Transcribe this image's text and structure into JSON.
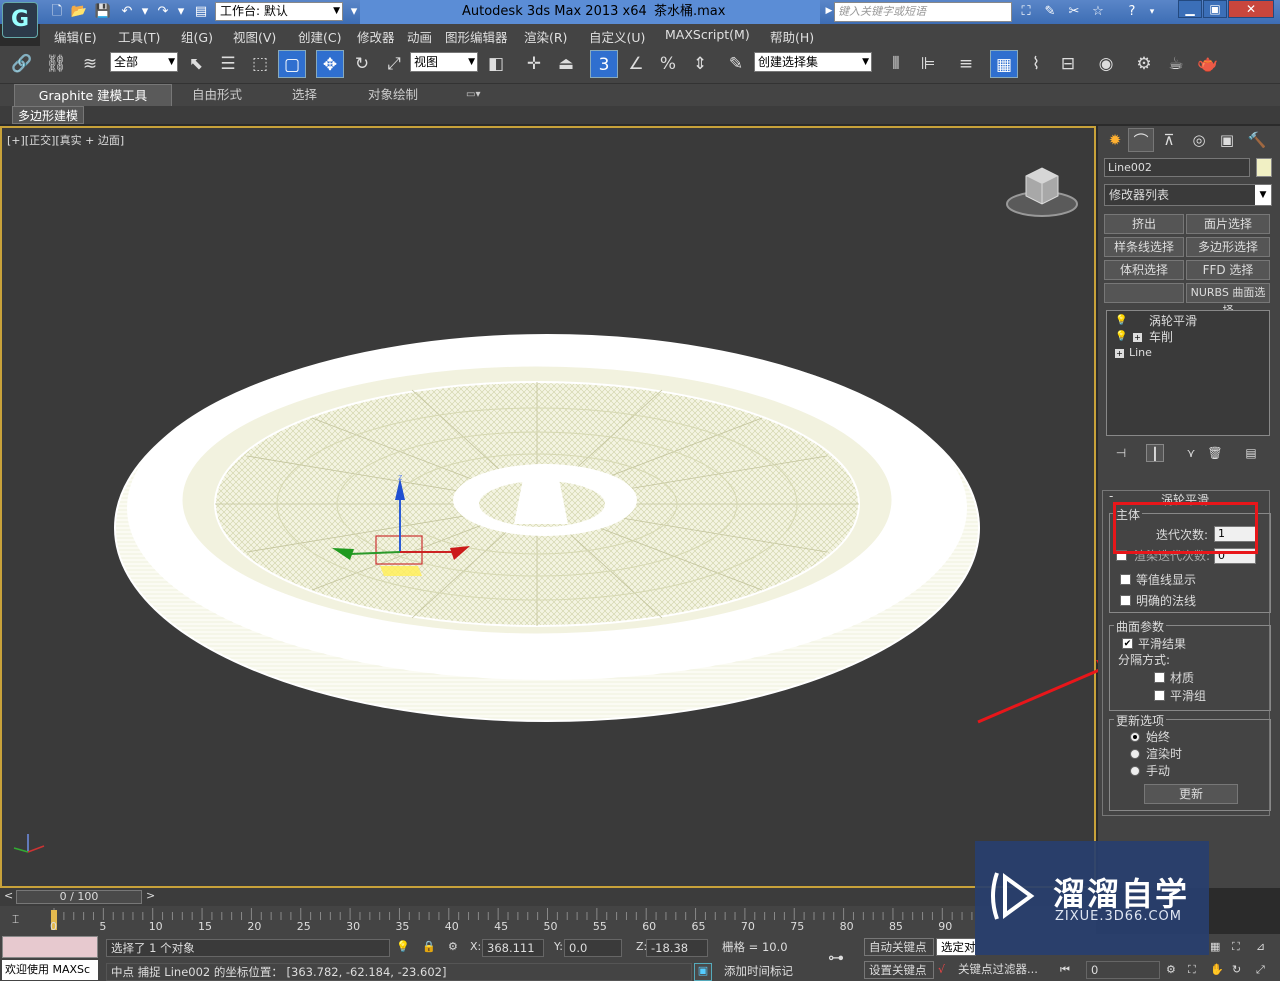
{
  "titlebar": {
    "workspace": "工作台: 默认",
    "app_title": "Autodesk 3ds Max  2013 x64",
    "file_name": "茶水桶.max",
    "search_placeholder": "键入关键字或短语"
  },
  "menu": [
    "编辑(E)",
    "工具(T)",
    "组(G)",
    "视图(V)",
    "创建(C)",
    "修改器",
    "动画",
    "图形编辑器",
    "渲染(R)",
    "自定义(U)",
    "MAXScript(M)",
    "帮助(H)"
  ],
  "toolbar": {
    "selection_filter": "全部",
    "ref_coord": "视图",
    "snap_value": "3",
    "named_selection": "创建选择集"
  },
  "ribbon": {
    "tabs": [
      "Graphite 建模工具",
      "自由形式",
      "选择",
      "对象绘制"
    ],
    "sub_tab": "多边形建模"
  },
  "viewport": {
    "label": "[+][正交][真实 + 边面]"
  },
  "panel": {
    "object_name": "Line002",
    "object_color": "#f1f0c4",
    "modifier_list": "修改器列表",
    "buttons": [
      "挤出",
      "面片选择",
      "样条线选择",
      "多边形选择",
      "体积选择",
      "FFD 选择",
      "",
      "NURBS 曲面选择"
    ],
    "stack": [
      "涡轮平滑",
      "车削",
      "Line"
    ],
    "turbosmooth": {
      "title": "涡轮平滑",
      "main_group": "主体",
      "iterations_label": "迭代次数:",
      "iterations": "1",
      "render_iters_label": "渲染迭代次数:",
      "render_iters": "0",
      "isoline_label": "等值线显示",
      "explicit_normals_label": "明确的法线",
      "surface_group": "曲面参数",
      "smooth_result_label": "平滑结果",
      "separate_by": "分隔方式:",
      "material_label": "材质",
      "smoothing_group_label": "平滑组",
      "update_group": "更新选项",
      "always_label": "始终",
      "render_label": "渲染时",
      "manual_label": "手动",
      "update_button": "更新"
    }
  },
  "timeline": {
    "frame_display": "0 / 100",
    "ticks": [
      "0",
      "5",
      "10",
      "15",
      "20",
      "25",
      "30",
      "35",
      "40",
      "45",
      "50",
      "55",
      "60",
      "65",
      "70",
      "75",
      "80",
      "85",
      "90"
    ]
  },
  "status": {
    "selected": "选择了 1 个对象",
    "prompt": "中点 捕捉 Line002 的坐标位置：  [363.782, -62.184, -23.602]",
    "welcome": "欢迎使用 MAXSc",
    "x_label": "X:",
    "x": "368.111",
    "y_label": "Y:",
    "y": "0.0",
    "z_label": "Z:",
    "z": "-18.38",
    "grid": "栅格 = 10.0",
    "auto_key": "自动关键点",
    "set_key": "设置关键点",
    "selected_obj": "选定对",
    "key_filters": "关键点过滤器...",
    "add_time_tag": "添加时间标记",
    "frame_field": "0"
  },
  "watermark": {
    "title": "溜溜自学",
    "url": "ZIXUE.3D66.COM"
  }
}
